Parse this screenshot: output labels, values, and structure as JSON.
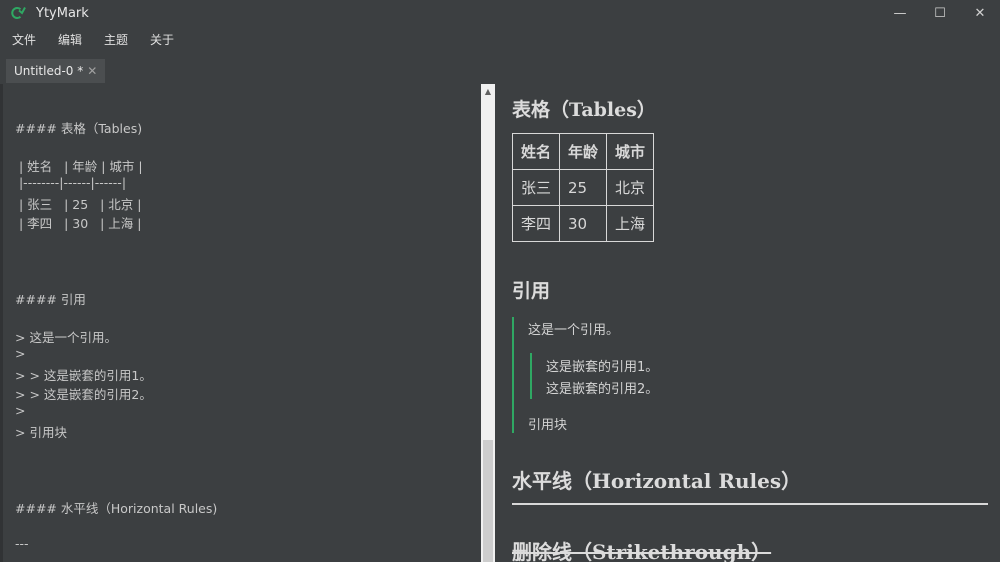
{
  "app": {
    "title": "YtyMark",
    "icon": "ytymark-logo-icon",
    "accent": "#2fa863"
  },
  "window_controls": {
    "minimize": "—",
    "maximize": "☐",
    "close": "✕"
  },
  "menu": [
    "文件",
    "编辑",
    "主题",
    "关于"
  ],
  "tab": {
    "label": "Untitled-0 *",
    "close": "✕"
  },
  "editor": {
    "lines": [
      "#### 表格（Tables)",
      " | 姓名   | 年龄 | 城市 |",
      " |--------|------|------|",
      " | 张三   | 25   | 北京 |",
      " | 李四   | 30   | 上海 |",
      "#### 引用",
      "> 这是一个引用。",
      ">",
      "> > 这是嵌套的引用1。",
      "> > 这是嵌套的引用2。",
      ">",
      "> 引用块",
      "#### 水平线（Horizontal Rules)",
      "---"
    ]
  },
  "preview": {
    "tables_heading": "表格（Tables）",
    "table": {
      "headers": [
        "姓名",
        "年龄",
        "城市"
      ],
      "rows": [
        [
          "张三",
          "25",
          "北京"
        ],
        [
          "李四",
          "30",
          "上海"
        ]
      ]
    },
    "quote_heading": "引用",
    "quote_line": "这是一个引用。",
    "nested_quote": [
      "这是嵌套的引用1。",
      "这是嵌套的引用2。"
    ],
    "quote_block": "引用块",
    "hr_heading": "水平线（Horizontal Rules）",
    "strike_heading": "删除线（Strikethrough）"
  }
}
